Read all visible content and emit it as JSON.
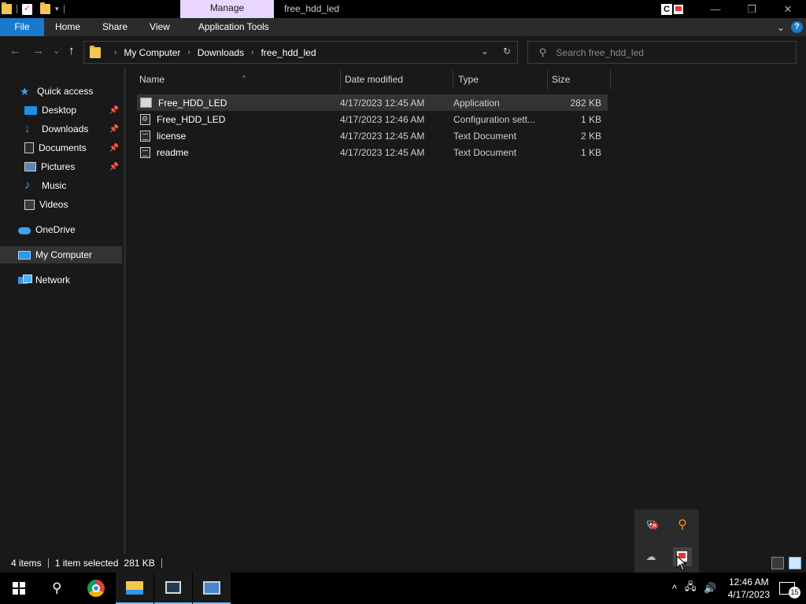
{
  "titlebar": {
    "context_tab": "Manage",
    "title": "free_hdd_led",
    "badge_letter": "C",
    "minimize": "—",
    "restore": "❐",
    "close": "✕"
  },
  "ribbon": {
    "tabs": [
      "File",
      "Home",
      "Share",
      "View",
      "Application Tools"
    ],
    "expand": "⌄",
    "help": "?"
  },
  "nav": {
    "back": "←",
    "forward": "→",
    "recent": "⌄",
    "up": "↑"
  },
  "address": {
    "crumbs": [
      "My Computer",
      "Downloads",
      "free_hdd_led"
    ],
    "dropdown": "⌄",
    "refresh": "↻"
  },
  "search": {
    "placeholder": "Search free_hdd_led"
  },
  "sidebar": {
    "items": [
      {
        "label": "Quick access",
        "icon": "star-icon"
      },
      {
        "label": "Desktop",
        "icon": "desktop-icon",
        "pinned": true
      },
      {
        "label": "Downloads",
        "icon": "download-icon",
        "pinned": true
      },
      {
        "label": "Documents",
        "icon": "document-icon",
        "pinned": true
      },
      {
        "label": "Pictures",
        "icon": "pictures-icon",
        "pinned": true
      },
      {
        "label": "Music",
        "icon": "music-icon"
      },
      {
        "label": "Videos",
        "icon": "videos-icon"
      },
      {
        "label": "OneDrive",
        "icon": "onedrive-icon"
      },
      {
        "label": "My Computer",
        "icon": "computer-icon",
        "selected": true
      },
      {
        "label": "Network",
        "icon": "network-icon"
      }
    ]
  },
  "columns": [
    "Name",
    "Date modified",
    "Type",
    "Size"
  ],
  "files": [
    {
      "name": "Free_HDD_LED",
      "date": "4/17/2023 12:45 AM",
      "type": "Application",
      "size": "282 KB",
      "icon": "application-icon",
      "selected": true
    },
    {
      "name": "Free_HDD_LED",
      "date": "4/17/2023 12:46 AM",
      "type": "Configuration sett...",
      "size": "1 KB",
      "icon": "config-file-icon"
    },
    {
      "name": "license",
      "date": "4/17/2023 12:45 AM",
      "type": "Text Document",
      "size": "2 KB",
      "icon": "text-file-icon"
    },
    {
      "name": "readme",
      "date": "4/17/2023 12:45 AM",
      "type": "Text Document",
      "size": "1 KB",
      "icon": "text-file-icon"
    }
  ],
  "status": {
    "item_count": "4 items",
    "selection": "1 item selected",
    "selection_size": "281 KB"
  },
  "taskbar": {
    "time": "12:46 AM",
    "date": "4/17/2023",
    "notifications": "15",
    "tray_chevron": "^",
    "volume": "🔊"
  },
  "colors": {
    "accent": "#1979ca",
    "manage_tab": "#e8d6ff",
    "background": "#191919"
  }
}
